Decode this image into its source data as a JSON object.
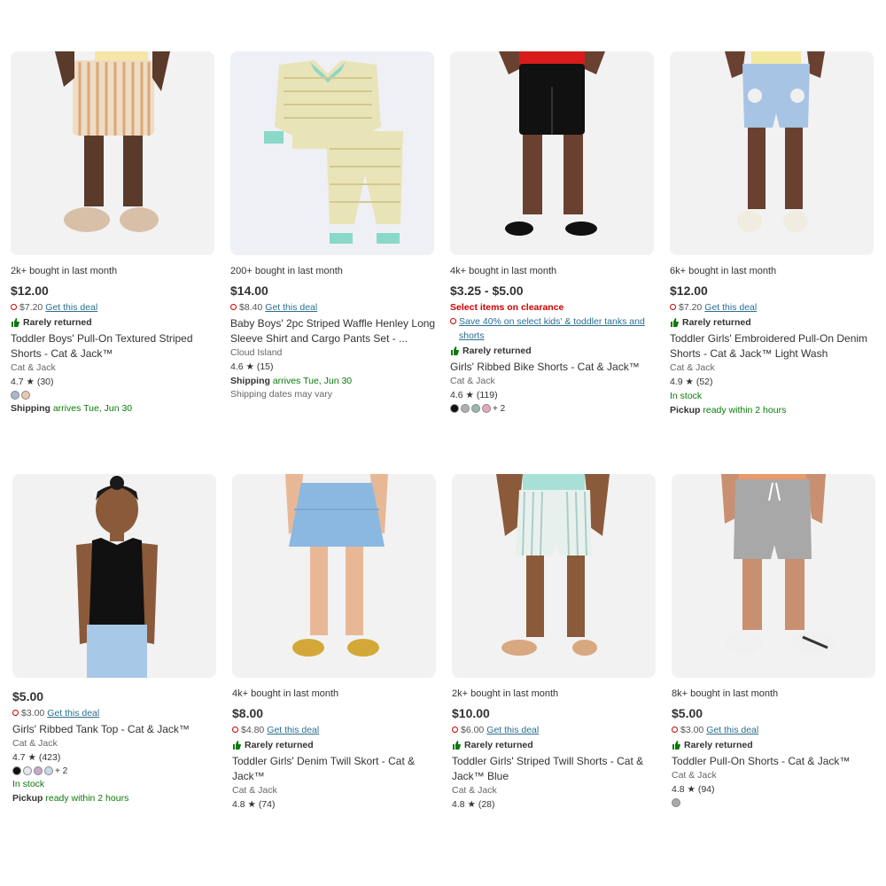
{
  "products": [
    {
      "bought": "2k+ bought in last month",
      "price": "$12.00",
      "deal_price": "$7.20",
      "deal_link": "Get this deal",
      "rarely": "Rarely returned",
      "title": "Toddler Boys' Pull-On Textured Striped Shorts - Cat & Jack™",
      "brand": "Cat & Jack",
      "rating": "4.7 ★ (30)",
      "swatch_colors": [
        "#a8b8d0",
        "#e8c8b0"
      ],
      "shipping_label": "Shipping",
      "shipping_value": "arrives Tue, Jun 30"
    },
    {
      "bought": "200+ bought in last month",
      "price": "$14.00",
      "deal_price": "$8.40",
      "deal_link": "Get this deal",
      "title": "Baby Boys' 2pc Striped Waffle Henley Long Sleeve Shirt and Cargo Pants Set - ...",
      "brand": "Cloud Island",
      "rating": "4.6 ★ (15)",
      "shipping_label": "Shipping",
      "shipping_value": "arrives Tue, Jun 30",
      "note": "Shipping dates may vary"
    },
    {
      "bought": "4k+ bought in last month",
      "price": "$3.25 - $5.00",
      "clearance": "Select items on clearance",
      "promo": "Save 40% on select kids' & toddler tanks and shorts",
      "rarely": "Rarely returned",
      "title": "Girls' Ribbed Bike Shorts - Cat & Jack™",
      "brand": "Cat & Jack",
      "rating": "4.6 ★ (119)",
      "swatch_colors": [
        "#111111",
        "#b0b0b0",
        "#9ab8a8",
        "#e8a8b8"
      ],
      "swatch_more": "+ 2"
    },
    {
      "bought": "6k+ bought in last month",
      "price": "$12.00",
      "deal_price": "$7.20",
      "deal_link": "Get this deal",
      "rarely": "Rarely returned",
      "title": "Toddler Girls' Embroidered Pull-On Denim Shorts - Cat & Jack™ Light Wash",
      "brand": "Cat & Jack",
      "rating": "4.9 ★ (52)",
      "stock": "In stock",
      "pickup_label": "Pickup",
      "pickup_value": "ready within 2 hours"
    },
    {
      "price": "$5.00",
      "deal_price": "$3.00",
      "deal_link": "Get this deal",
      "title": "Girls' Ribbed Tank Top - Cat & Jack™",
      "brand": "Cat & Jack",
      "rating": "4.7 ★ (423)",
      "swatch_colors": [
        "#111111",
        "#e8e8f0",
        "#c8a8c8",
        "#c8d8e8"
      ],
      "swatch_more": "+ 2",
      "stock": "In stock",
      "pickup_label": "Pickup",
      "pickup_value": "ready within 2 hours"
    },
    {
      "bought": "4k+ bought in last month",
      "price": "$8.00",
      "deal_price": "$4.80",
      "deal_link": "Get this deal",
      "rarely": "Rarely returned",
      "title": "Toddler Girls' Denim Twill Skort - Cat & Jack™",
      "brand": "Cat & Jack",
      "rating": "4.8 ★ (74)"
    },
    {
      "bought": "2k+ bought in last month",
      "price": "$10.00",
      "deal_price": "$6.00",
      "deal_link": "Get this deal",
      "rarely": "Rarely returned",
      "title": "Toddler Girls' Striped Twill Shorts - Cat & Jack™ Blue",
      "brand": "Cat & Jack",
      "rating": "4.8 ★ (28)"
    },
    {
      "bought": "8k+ bought in last month",
      "price": "$5.00",
      "deal_price": "$3.00",
      "deal_link": "Get this deal",
      "rarely": "Rarely returned",
      "title": "Toddler Pull-On Shorts - Cat & Jack™",
      "brand": "Cat & Jack",
      "rating": "4.8 ★ (94)",
      "swatch_colors": [
        "#a8a8a8"
      ]
    }
  ]
}
